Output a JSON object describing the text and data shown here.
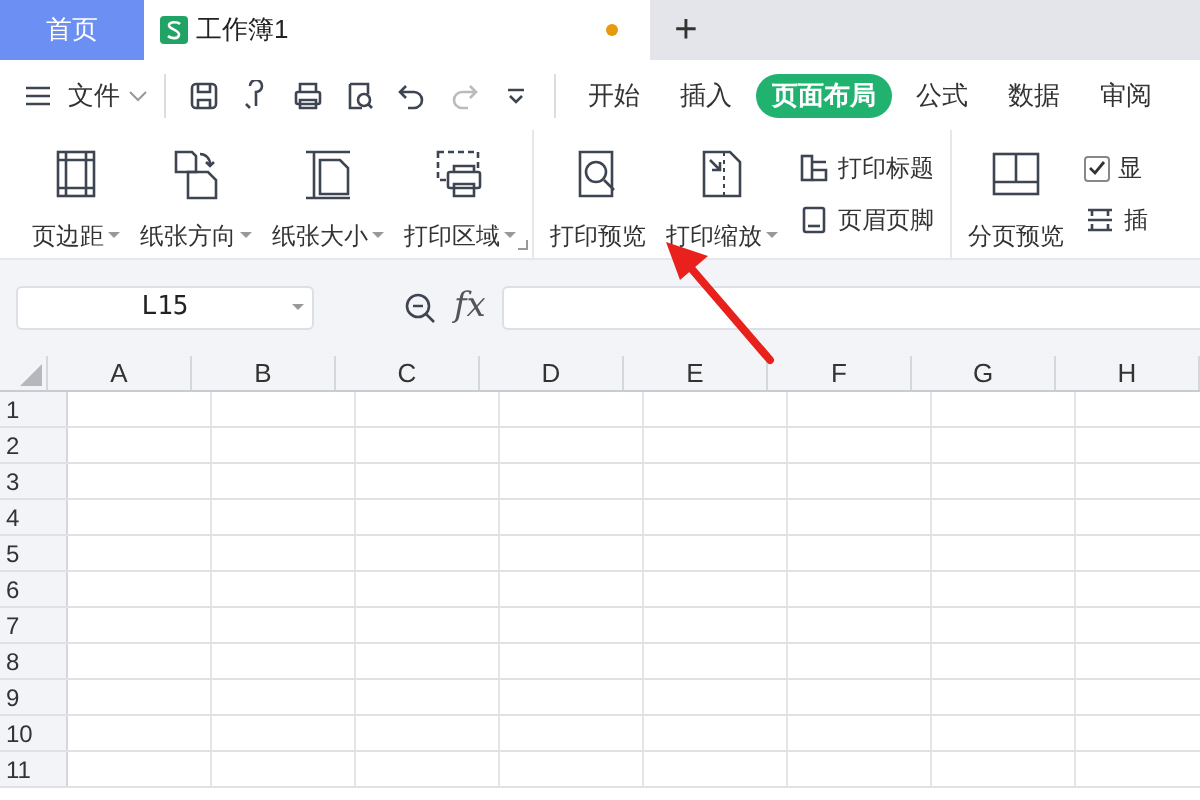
{
  "tabs": [
    {
      "label": "首页",
      "selected": false,
      "kind": "home"
    },
    {
      "label": "工作簿1",
      "selected": true,
      "kind": "document",
      "unsaved": true
    }
  ],
  "new_tab": "+",
  "file_menu": "文件",
  "ribbon_tabs": [
    {
      "label": "开始",
      "selected": false
    },
    {
      "label": "插入",
      "selected": false
    },
    {
      "label": "页面布局",
      "selected": true
    },
    {
      "label": "公式",
      "selected": false
    },
    {
      "label": "数据",
      "selected": false
    },
    {
      "label": "审阅",
      "selected": false
    }
  ],
  "ribbon_groups": [
    [
      {
        "kind": "large",
        "label": "页边距",
        "dropdown": true
      },
      {
        "kind": "large",
        "label": "纸张方向",
        "dropdown": true
      },
      {
        "kind": "large",
        "label": "纸张大小",
        "dropdown": true
      },
      {
        "kind": "large",
        "label": "打印区域",
        "dropdown": true
      }
    ],
    [
      {
        "kind": "large",
        "label": "打印预览",
        "dropdown": false
      },
      {
        "kind": "large",
        "label": "打印缩放",
        "dropdown": true
      },
      {
        "kind": "stack",
        "items": [
          {
            "label": "打印标题"
          },
          {
            "label": "页眉页脚"
          }
        ]
      }
    ],
    [
      {
        "kind": "large",
        "label": "分页预览",
        "dropdown": false
      },
      {
        "kind": "stack",
        "items": [
          {
            "label": "显",
            "checkbox": true,
            "checked": true
          },
          {
            "label": "插"
          }
        ]
      }
    ]
  ],
  "name_box": "L15",
  "formula_label": "fx",
  "columns": [
    "A",
    "B",
    "C",
    "D",
    "E",
    "F",
    "G",
    "H"
  ],
  "rows": [
    "1",
    "2",
    "3",
    "4",
    "5",
    "6",
    "7",
    "8",
    "9",
    "10",
    "11"
  ]
}
